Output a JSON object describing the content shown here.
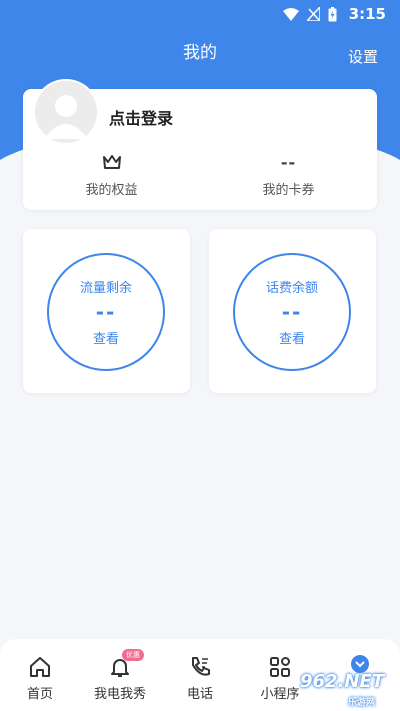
{
  "status_bar": {
    "time": "3:15"
  },
  "header": {
    "title": "我的",
    "settings_label": "设置"
  },
  "profile": {
    "login_label": "点击登录"
  },
  "benefits": [
    {
      "icon": "crown-icon",
      "value": "",
      "label": "我的权益"
    },
    {
      "icon": "",
      "value": "--",
      "label": "我的卡券"
    }
  ],
  "stats": [
    {
      "title": "流量剩余",
      "value": "--",
      "action": "查看"
    },
    {
      "title": "话费余额",
      "value": "--",
      "action": "查看"
    }
  ],
  "tabbar": {
    "items": [
      {
        "icon": "home-icon",
        "label": "首页"
      },
      {
        "icon": "bell-icon",
        "label": "我电我秀",
        "badge": "优惠"
      },
      {
        "icon": "phone-icon",
        "label": "电话"
      },
      {
        "icon": "grid-icon",
        "label": "小程序"
      },
      {
        "icon": "chevron-down-icon",
        "label": ""
      }
    ]
  },
  "watermark": {
    "text": "962.NET",
    "sub": "乐游网"
  },
  "colors": {
    "primary": "#3e86ea",
    "background": "#f4f6f9",
    "badge": "#f36b8e"
  }
}
